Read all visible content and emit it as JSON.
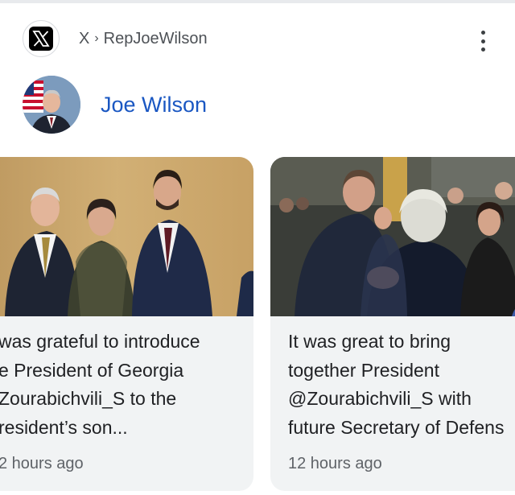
{
  "source": {
    "logo_icon": "x-logo-icon",
    "breadcrumb": {
      "site": "X",
      "separator": "›",
      "account": "RepJoeWilson"
    }
  },
  "profile": {
    "name": "Joe Wilson",
    "avatar_icon": "profile-avatar"
  },
  "menu_icon": "more-vertical-icon",
  "posts": [
    {
      "text_lines": [
        "was grateful to introduce",
        "e President of Georgia",
        "Zourabichvili_S to the",
        "resident’s son..."
      ],
      "time": "2 hours ago"
    },
    {
      "text_lines": [
        "It was great to bring",
        "together President",
        "@Zourabichvili_S with",
        "future Secretary of Defens"
      ],
      "time": "12 hours ago"
    }
  ],
  "colors": {
    "link_blue": "#1a57c2",
    "card_bg": "#f1f3f4",
    "text": "#202124",
    "muted": "#5f6368"
  }
}
